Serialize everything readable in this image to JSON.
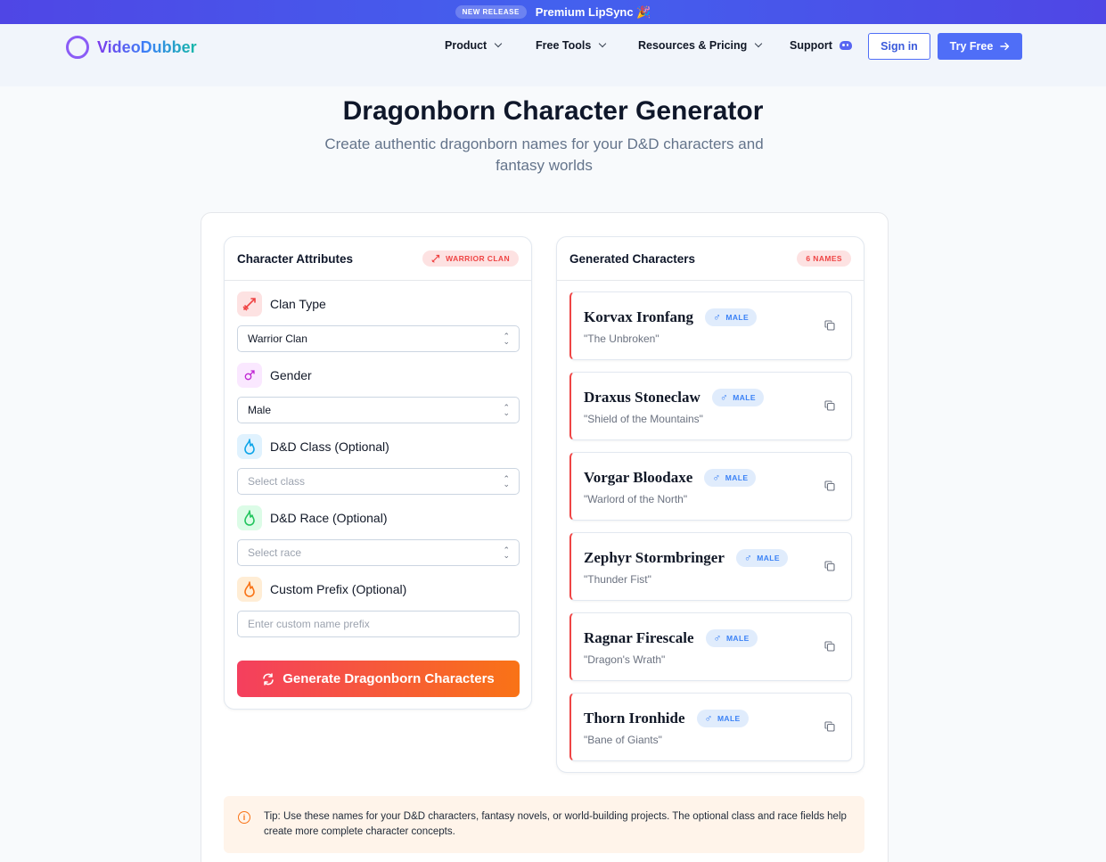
{
  "banner": {
    "tag": "NEW RELEASE",
    "text": "Premium LipSync 🎉"
  },
  "nav": {
    "logo": "VideoDubber",
    "items": [
      "Product",
      "Free Tools",
      "Resources & Pricing",
      "Support"
    ],
    "signin": "Sign in",
    "try": "Try Free"
  },
  "hero": {
    "title": "Dragonborn Character Generator",
    "subtitle": "Create authentic dragonborn names for your D&D characters and fantasy worlds"
  },
  "attributes": {
    "title": "Character Attributes",
    "badge": "WARRIOR CLAN",
    "clan_label": "Clan Type",
    "clan_value": "Warrior Clan",
    "gender_label": "Gender",
    "gender_value": "Male",
    "class_label": "D&D Class (Optional)",
    "class_placeholder": "Select class",
    "race_label": "D&D Race (Optional)",
    "race_placeholder": "Select race",
    "prefix_label": "Custom Prefix (Optional)",
    "prefix_placeholder": "Enter custom name prefix",
    "generate": "Generate Dragonborn Characters"
  },
  "results": {
    "title": "Generated Characters",
    "badge": "6 NAMES",
    "gender_symbol": "♂",
    "gender_badge": "MALE",
    "characters": [
      {
        "name": "Korvax Ironfang",
        "epithet": "\"The Unbroken\""
      },
      {
        "name": "Draxus Stoneclaw",
        "epithet": "\"Shield of the Mountains\""
      },
      {
        "name": "Vorgar Bloodaxe",
        "epithet": "\"Warlord of the North\""
      },
      {
        "name": "Zephyr Stormbringer",
        "epithet": "\"Thunder Fist\""
      },
      {
        "name": "Ragnar Firescale",
        "epithet": "\"Dragon's Wrath\""
      },
      {
        "name": "Thorn Ironhide",
        "epithet": "\"Bane of Giants\""
      }
    ]
  },
  "tip": {
    "icon": "i",
    "text": "Tip: Use these names for your D&D characters, fantasy novels, or world-building projects. The optional class and race fields help create more complete character concepts."
  },
  "colors": {
    "accent": "#4f6ef7",
    "warrior": "#ef4444",
    "gradient_end": "#f97316",
    "male": "#3b82f6"
  },
  "icons": [
    "sword-icon",
    "male-icon",
    "flame-icon",
    "copy-icon",
    "refresh-icon",
    "info-icon",
    "discord-icon",
    "arrow-right-icon"
  ]
}
